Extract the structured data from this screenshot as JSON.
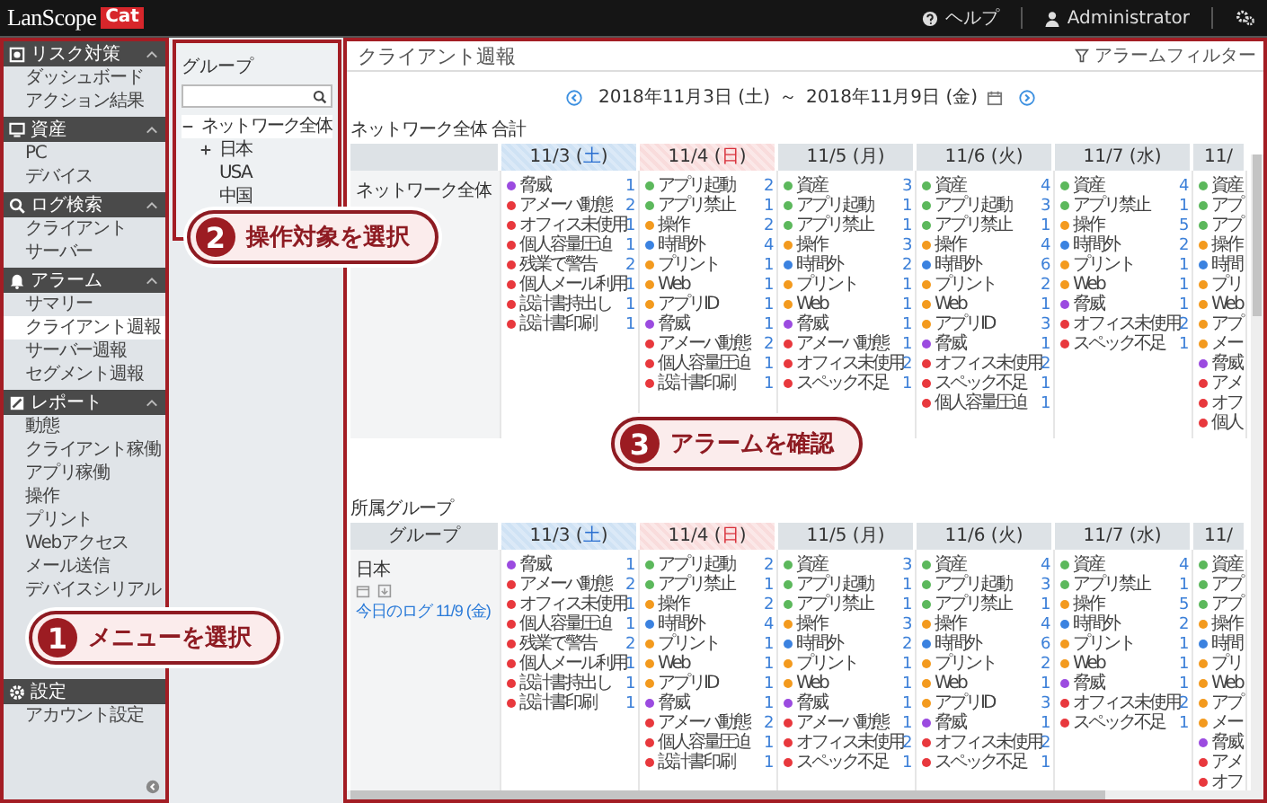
{
  "header": {
    "logo_text": "LanScope",
    "logo_badge": "Cat",
    "help": "ヘルプ",
    "user": "Administrator"
  },
  "sidebar": [
    {
      "title": "リスク対策",
      "expanded": true,
      "items": [
        {
          "label": "ダッシュボード",
          "selected": false
        },
        {
          "label": "アクション結果",
          "selected": false
        }
      ]
    },
    {
      "title": "資産",
      "expanded": true,
      "items": [
        {
          "label": "PC",
          "selected": false
        },
        {
          "label": "デバイス",
          "selected": false
        }
      ]
    },
    {
      "title": "ログ検索",
      "expanded": true,
      "items": [
        {
          "label": "クライアント",
          "selected": false
        },
        {
          "label": "サーバー",
          "selected": false
        }
      ]
    },
    {
      "title": "アラーム",
      "expanded": true,
      "items": [
        {
          "label": "サマリー",
          "selected": false
        },
        {
          "label": "クライアント週報",
          "selected": true
        },
        {
          "label": "サーバー週報",
          "selected": false
        },
        {
          "label": "セグメント週報",
          "selected": false
        }
      ]
    },
    {
      "title": "レポート",
      "expanded": true,
      "items": [
        {
          "label": "動態",
          "selected": false
        },
        {
          "label": "クライアント稼働",
          "selected": false
        },
        {
          "label": "アプリ稼働",
          "selected": false
        },
        {
          "label": "操作",
          "selected": false
        },
        {
          "label": "プリント",
          "selected": false
        },
        {
          "label": "Webアクセス",
          "selected": false
        },
        {
          "label": "メール送信",
          "selected": false
        },
        {
          "label": "デバイスシリアル",
          "selected": false
        }
      ]
    },
    {
      "title": "設定",
      "items": [
        {
          "label": "アカウント設定",
          "selected": false
        }
      ]
    }
  ],
  "group_panel": {
    "title": "グループ",
    "tree": [
      {
        "label": "ネットワーク全体",
        "expanded": true,
        "selected": true,
        "children": [
          {
            "label": "日本",
            "expanded": false,
            "selected": false
          },
          {
            "label": "USA",
            "selected": false
          },
          {
            "label": "中国",
            "selected": false
          }
        ]
      }
    ]
  },
  "main": {
    "title": "クライアント週報",
    "filter": "アラームフィルター",
    "date_from": "2018年11月3日 (土)",
    "date_sep": "～",
    "date_to": "2018年11月9日 (金)",
    "sections": [
      {
        "label": "ネットワーク全体 合計",
        "row_label": "ネットワーク全体",
        "columns": [
          {
            "date": "11/3 (",
            "weekday": "土",
            "after": ")",
            "kind": "saturday",
            "items": [
              {
                "label": "脅威",
                "count": "1",
                "color": "#9b4be0"
              },
              {
                "label": "アメーバ動態",
                "count": "2",
                "color": "#e8383d"
              },
              {
                "label": "オフィス未使用",
                "count": "1",
                "color": "#e8383d"
              },
              {
                "label": "個人容量圧迫",
                "count": "1",
                "color": "#e8383d"
              },
              {
                "label": "残業で警告",
                "count": "2",
                "color": "#e8383d"
              },
              {
                "label": "個人メール利用",
                "count": "1",
                "color": "#e8383d"
              },
              {
                "label": "設計書持出し",
                "count": "1",
                "color": "#e8383d"
              },
              {
                "label": "設計書印刷",
                "count": "1",
                "color": "#e8383d"
              }
            ]
          },
          {
            "date": "11/4 (",
            "weekday": "日",
            "after": ")",
            "kind": "sunday",
            "items": [
              {
                "label": "アプリ起動",
                "count": "2",
                "color": "#5cb85c"
              },
              {
                "label": "アプリ禁止",
                "count": "1",
                "color": "#5cb85c"
              },
              {
                "label": "操作",
                "count": "2",
                "color": "#f39a1e"
              },
              {
                "label": "時間外",
                "count": "4",
                "color": "#3b82e0"
              },
              {
                "label": "プリント",
                "count": "1",
                "color": "#f39a1e"
              },
              {
                "label": "Web",
                "count": "1",
                "color": "#f39a1e"
              },
              {
                "label": "アプリID",
                "count": "1",
                "color": "#f39a1e"
              },
              {
                "label": "脅威",
                "count": "1",
                "color": "#9b4be0"
              },
              {
                "label": "アメーバ動態",
                "count": "2",
                "color": "#e8383d"
              },
              {
                "label": "個人容量圧迫",
                "count": "1",
                "color": "#e8383d"
              },
              {
                "label": "設計書印刷",
                "count": "1",
                "color": "#e8383d"
              }
            ]
          },
          {
            "date": "11/5 (",
            "weekday": "月",
            "after": ")",
            "kind": "weekday",
            "items": [
              {
                "label": "資産",
                "count": "3",
                "color": "#5cb85c"
              },
              {
                "label": "アプリ起動",
                "count": "1",
                "color": "#5cb85c"
              },
              {
                "label": "アプリ禁止",
                "count": "1",
                "color": "#5cb85c"
              },
              {
                "label": "操作",
                "count": "3",
                "color": "#f39a1e"
              },
              {
                "label": "時間外",
                "count": "2",
                "color": "#3b82e0"
              },
              {
                "label": "プリント",
                "count": "1",
                "color": "#f39a1e"
              },
              {
                "label": "Web",
                "count": "1",
                "color": "#f39a1e"
              },
              {
                "label": "脅威",
                "count": "1",
                "color": "#9b4be0"
              },
              {
                "label": "アメーバ動態",
                "count": "1",
                "color": "#e8383d"
              },
              {
                "label": "オフィス未使用",
                "count": "2",
                "color": "#e8383d"
              },
              {
                "label": "スペック不足",
                "count": "1",
                "color": "#e8383d"
              }
            ]
          },
          {
            "date": "11/6 (",
            "weekday": "火",
            "after": ")",
            "kind": "weekday",
            "items": [
              {
                "label": "資産",
                "count": "4",
                "color": "#5cb85c"
              },
              {
                "label": "アプリ起動",
                "count": "3",
                "color": "#5cb85c"
              },
              {
                "label": "アプリ禁止",
                "count": "1",
                "color": "#5cb85c"
              },
              {
                "label": "操作",
                "count": "4",
                "color": "#f39a1e"
              },
              {
                "label": "時間外",
                "count": "6",
                "color": "#3b82e0"
              },
              {
                "label": "プリント",
                "count": "2",
                "color": "#f39a1e"
              },
              {
                "label": "Web",
                "count": "1",
                "color": "#f39a1e"
              },
              {
                "label": "アプリID",
                "count": "3",
                "color": "#f39a1e"
              },
              {
                "label": "脅威",
                "count": "1",
                "color": "#9b4be0"
              },
              {
                "label": "オフィス未使用",
                "count": "2",
                "color": "#e8383d"
              },
              {
                "label": "スペック不足",
                "count": "1",
                "color": "#e8383d"
              },
              {
                "label": "個人容量圧迫",
                "count": "1",
                "color": "#e8383d"
              }
            ]
          },
          {
            "date": "11/7 (",
            "weekday": "水",
            "after": ")",
            "kind": "weekday",
            "items": [
              {
                "label": "資産",
                "count": "4",
                "color": "#5cb85c"
              },
              {
                "label": "アプリ禁止",
                "count": "1",
                "color": "#5cb85c"
              },
              {
                "label": "操作",
                "count": "5",
                "color": "#f39a1e"
              },
              {
                "label": "時間外",
                "count": "2",
                "color": "#3b82e0"
              },
              {
                "label": "プリント",
                "count": "1",
                "color": "#f39a1e"
              },
              {
                "label": "Web",
                "count": "1",
                "color": "#f39a1e"
              },
              {
                "label": "脅威",
                "count": "1",
                "color": "#9b4be0"
              },
              {
                "label": "オフィス未使用",
                "count": "2",
                "color": "#e8383d"
              },
              {
                "label": "スペック不足",
                "count": "1",
                "color": "#e8383d"
              }
            ]
          },
          {
            "date": "11/",
            "kind": "weekday",
            "items": [
              {
                "label": "資産",
                "color": "#5cb85c"
              },
              {
                "label": "アプ",
                "color": "#5cb85c"
              },
              {
                "label": "アプ",
                "color": "#5cb85c"
              },
              {
                "label": "操作",
                "color": "#f39a1e"
              },
              {
                "label": "時間",
                "color": "#3b82e0"
              },
              {
                "label": "プリ",
                "color": "#f39a1e"
              },
              {
                "label": "Web",
                "color": "#f39a1e"
              },
              {
                "label": "アプ",
                "color": "#f39a1e"
              },
              {
                "label": "メー",
                "color": "#f39a1e"
              },
              {
                "label": "脅威",
                "color": "#9b4be0"
              },
              {
                "label": "アメ",
                "color": "#e8383d"
              },
              {
                "label": "オフ",
                "color": "#e8383d"
              },
              {
                "label": "個人",
                "color": "#e8383d"
              }
            ]
          }
        ]
      },
      {
        "label": "所属グループ",
        "first_header": "グループ",
        "row_label": "日本",
        "row_tools": true,
        "row_link": "今日のログ 11/9 (金)",
        "columns": [
          {
            "date": "11/3 (",
            "weekday": "土",
            "after": ")",
            "kind": "saturday",
            "items": [
              {
                "label": "脅威",
                "count": "1",
                "color": "#9b4be0"
              },
              {
                "label": "アメーバ動態",
                "count": "2",
                "color": "#e8383d"
              },
              {
                "label": "オフィス未使用",
                "count": "1",
                "color": "#e8383d"
              },
              {
                "label": "個人容量圧迫",
                "count": "1",
                "color": "#e8383d"
              },
              {
                "label": "残業で警告",
                "count": "2",
                "color": "#e8383d"
              },
              {
                "label": "個人メール利用",
                "count": "1",
                "color": "#e8383d"
              },
              {
                "label": "設計書持出し",
                "count": "1",
                "color": "#e8383d"
              },
              {
                "label": "設計書印刷",
                "count": "1",
                "color": "#e8383d"
              }
            ]
          },
          {
            "date": "11/4 (",
            "weekday": "日",
            "after": ")",
            "kind": "sunday",
            "items": [
              {
                "label": "アプリ起動",
                "count": "2",
                "color": "#5cb85c"
              },
              {
                "label": "アプリ禁止",
                "count": "1",
                "color": "#5cb85c"
              },
              {
                "label": "操作",
                "count": "2",
                "color": "#f39a1e"
              },
              {
                "label": "時間外",
                "count": "4",
                "color": "#3b82e0"
              },
              {
                "label": "プリント",
                "count": "1",
                "color": "#f39a1e"
              },
              {
                "label": "Web",
                "count": "1",
                "color": "#f39a1e"
              },
              {
                "label": "アプリID",
                "count": "1",
                "color": "#f39a1e"
              },
              {
                "label": "脅威",
                "count": "1",
                "color": "#9b4be0"
              },
              {
                "label": "アメーバ動態",
                "count": "2",
                "color": "#e8383d"
              },
              {
                "label": "個人容量圧迫",
                "count": "1",
                "color": "#e8383d"
              },
              {
                "label": "設計書印刷",
                "count": "1",
                "color": "#e8383d"
              }
            ]
          },
          {
            "date": "11/5 (",
            "weekday": "月",
            "after": ")",
            "kind": "weekday",
            "items": [
              {
                "label": "資産",
                "count": "3",
                "color": "#5cb85c"
              },
              {
                "label": "アプリ起動",
                "count": "1",
                "color": "#5cb85c"
              },
              {
                "label": "アプリ禁止",
                "count": "1",
                "color": "#5cb85c"
              },
              {
                "label": "操作",
                "count": "3",
                "color": "#f39a1e"
              },
              {
                "label": "時間外",
                "count": "2",
                "color": "#3b82e0"
              },
              {
                "label": "プリント",
                "count": "1",
                "color": "#f39a1e"
              },
              {
                "label": "Web",
                "count": "1",
                "color": "#f39a1e"
              },
              {
                "label": "脅威",
                "count": "1",
                "color": "#9b4be0"
              },
              {
                "label": "アメーバ動態",
                "count": "1",
                "color": "#e8383d"
              },
              {
                "label": "オフィス未使用",
                "count": "2",
                "color": "#e8383d"
              },
              {
                "label": "スペック不足",
                "count": "1",
                "color": "#e8383d"
              }
            ]
          },
          {
            "date": "11/6 (",
            "weekday": "火",
            "after": ")",
            "kind": "weekday",
            "items": [
              {
                "label": "資産",
                "count": "4",
                "color": "#5cb85c"
              },
              {
                "label": "アプリ起動",
                "count": "3",
                "color": "#5cb85c"
              },
              {
                "label": "アプリ禁止",
                "count": "1",
                "color": "#5cb85c"
              },
              {
                "label": "操作",
                "count": "4",
                "color": "#f39a1e"
              },
              {
                "label": "時間外",
                "count": "6",
                "color": "#3b82e0"
              },
              {
                "label": "プリント",
                "count": "2",
                "color": "#f39a1e"
              },
              {
                "label": "Web",
                "count": "1",
                "color": "#f39a1e"
              },
              {
                "label": "アプリID",
                "count": "3",
                "color": "#f39a1e"
              },
              {
                "label": "脅威",
                "count": "1",
                "color": "#9b4be0"
              },
              {
                "label": "オフィス未使用",
                "count": "2",
                "color": "#e8383d"
              },
              {
                "label": "スペック不足",
                "count": "1",
                "color": "#e8383d"
              }
            ]
          },
          {
            "date": "11/7 (",
            "weekday": "水",
            "after": ")",
            "kind": "weekday",
            "items": [
              {
                "label": "資産",
                "count": "4",
                "color": "#5cb85c"
              },
              {
                "label": "アプリ禁止",
                "count": "1",
                "color": "#5cb85c"
              },
              {
                "label": "操作",
                "count": "5",
                "color": "#f39a1e"
              },
              {
                "label": "時間外",
                "count": "2",
                "color": "#3b82e0"
              },
              {
                "label": "プリント",
                "count": "1",
                "color": "#f39a1e"
              },
              {
                "label": "Web",
                "count": "1",
                "color": "#f39a1e"
              },
              {
                "label": "脅威",
                "count": "1",
                "color": "#9b4be0"
              },
              {
                "label": "オフィス未使用",
                "count": "2",
                "color": "#e8383d"
              },
              {
                "label": "スペック不足",
                "count": "1",
                "color": "#e8383d"
              }
            ]
          },
          {
            "date": "11/",
            "kind": "weekday",
            "items": [
              {
                "label": "資産",
                "color": "#5cb85c"
              },
              {
                "label": "アプ",
                "color": "#5cb85c"
              },
              {
                "label": "アプ",
                "color": "#5cb85c"
              },
              {
                "label": "操作",
                "color": "#f39a1e"
              },
              {
                "label": "時間",
                "color": "#3b82e0"
              },
              {
                "label": "プリ",
                "color": "#f39a1e"
              },
              {
                "label": "Web",
                "color": "#f39a1e"
              },
              {
                "label": "アプ",
                "color": "#f39a1e"
              },
              {
                "label": "メー",
                "color": "#f39a1e"
              },
              {
                "label": "脅威",
                "color": "#9b4be0"
              },
              {
                "label": "アメ",
                "color": "#e8383d"
              },
              {
                "label": "オフ",
                "color": "#e8383d"
              }
            ]
          }
        ]
      }
    ]
  },
  "callouts": [
    {
      "number": "1",
      "text": "メニューを選択"
    },
    {
      "number": "2",
      "text": "操作対象を選択"
    },
    {
      "number": "3",
      "text": "アラームを確認"
    }
  ]
}
